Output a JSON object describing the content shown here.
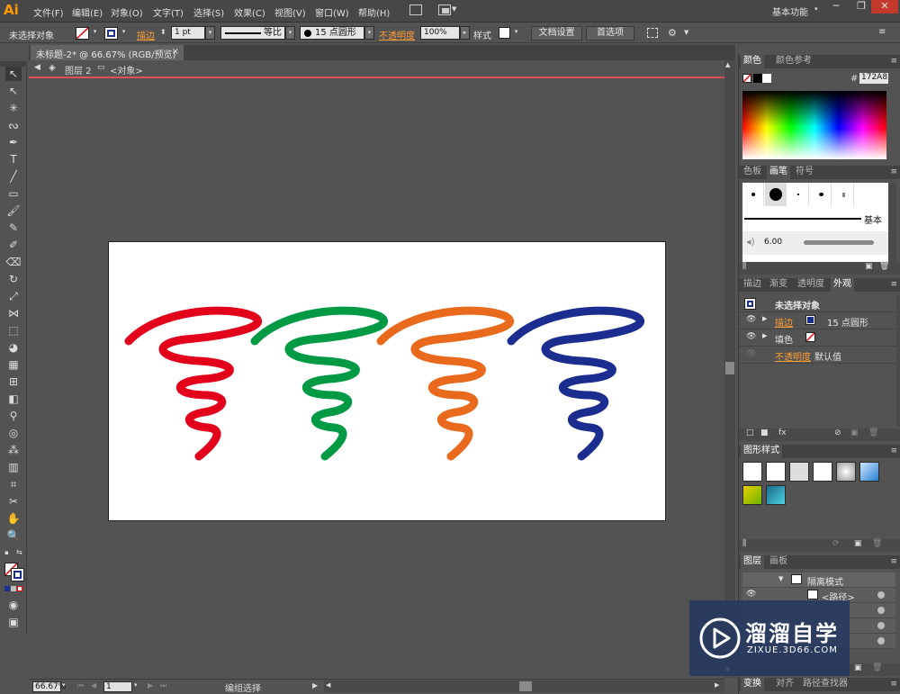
{
  "app": {
    "logo": "Ai",
    "menu": [
      "文件(F)",
      "编辑(E)",
      "对象(O)",
      "文字(T)",
      "选择(S)",
      "效果(C)",
      "视图(V)",
      "窗口(W)",
      "帮助(H)"
    ],
    "workspace": "基本功能",
    "window_controls": [
      "─",
      "❐",
      "✕"
    ]
  },
  "controlbar": {
    "selection_label": "未选择对象",
    "stroke_label": "描边",
    "stroke_weight": "1 pt",
    "profile_label": "等比",
    "brush_label": "15 点圆形",
    "opacity_label": "不透明度",
    "opacity_value": "100%",
    "style_label": "样式",
    "doc_setup_button": "文档设置",
    "prefs_button": "首选项"
  },
  "document": {
    "tab_title": "未标题-2* @ 66.67% (RGB/预览)",
    "tab_close": "×",
    "breadcrumb_layer": "图层 2",
    "breadcrumb_object": "<对象>",
    "zoom": "66.67%",
    "page": "1",
    "status_text": "编组选择"
  },
  "artwork": {
    "colors": [
      "#e3001b",
      "#009a44",
      "#e96a1d",
      "#1b2d8e"
    ],
    "stroke_width": 9
  },
  "color_panel": {
    "tabs": [
      "颜色",
      "颜色参考"
    ],
    "hash_label": "#",
    "hex_value": "172A8"
  },
  "brushes_panel": {
    "tabs": [
      "色板",
      "画笔",
      "符号"
    ],
    "basic_label": "基本",
    "size_value": "6.00"
  },
  "appearance_panel": {
    "tabs": [
      "描边",
      "渐变",
      "透明度",
      "外观"
    ],
    "title": "未选择对象",
    "rows": [
      {
        "label": "描边",
        "value": "15 点圆形"
      },
      {
        "label": "填色",
        "value": ""
      },
      {
        "label": "不透明度",
        "value": "默认值"
      }
    ]
  },
  "graphic_styles_panel": {
    "tabs": [
      "图形样式"
    ]
  },
  "layers_panel": {
    "tabs": [
      "图层",
      "画板"
    ],
    "rows": [
      {
        "label": "隔离模式"
      },
      {
        "label": "<路径>"
      }
    ]
  },
  "bottom_panel": {
    "tabs": [
      "变换",
      "对齐",
      "路径查找器"
    ]
  },
  "watermark": {
    "title": "溜溜自学",
    "subtitle": "ZIXUE.3D66.COM"
  }
}
